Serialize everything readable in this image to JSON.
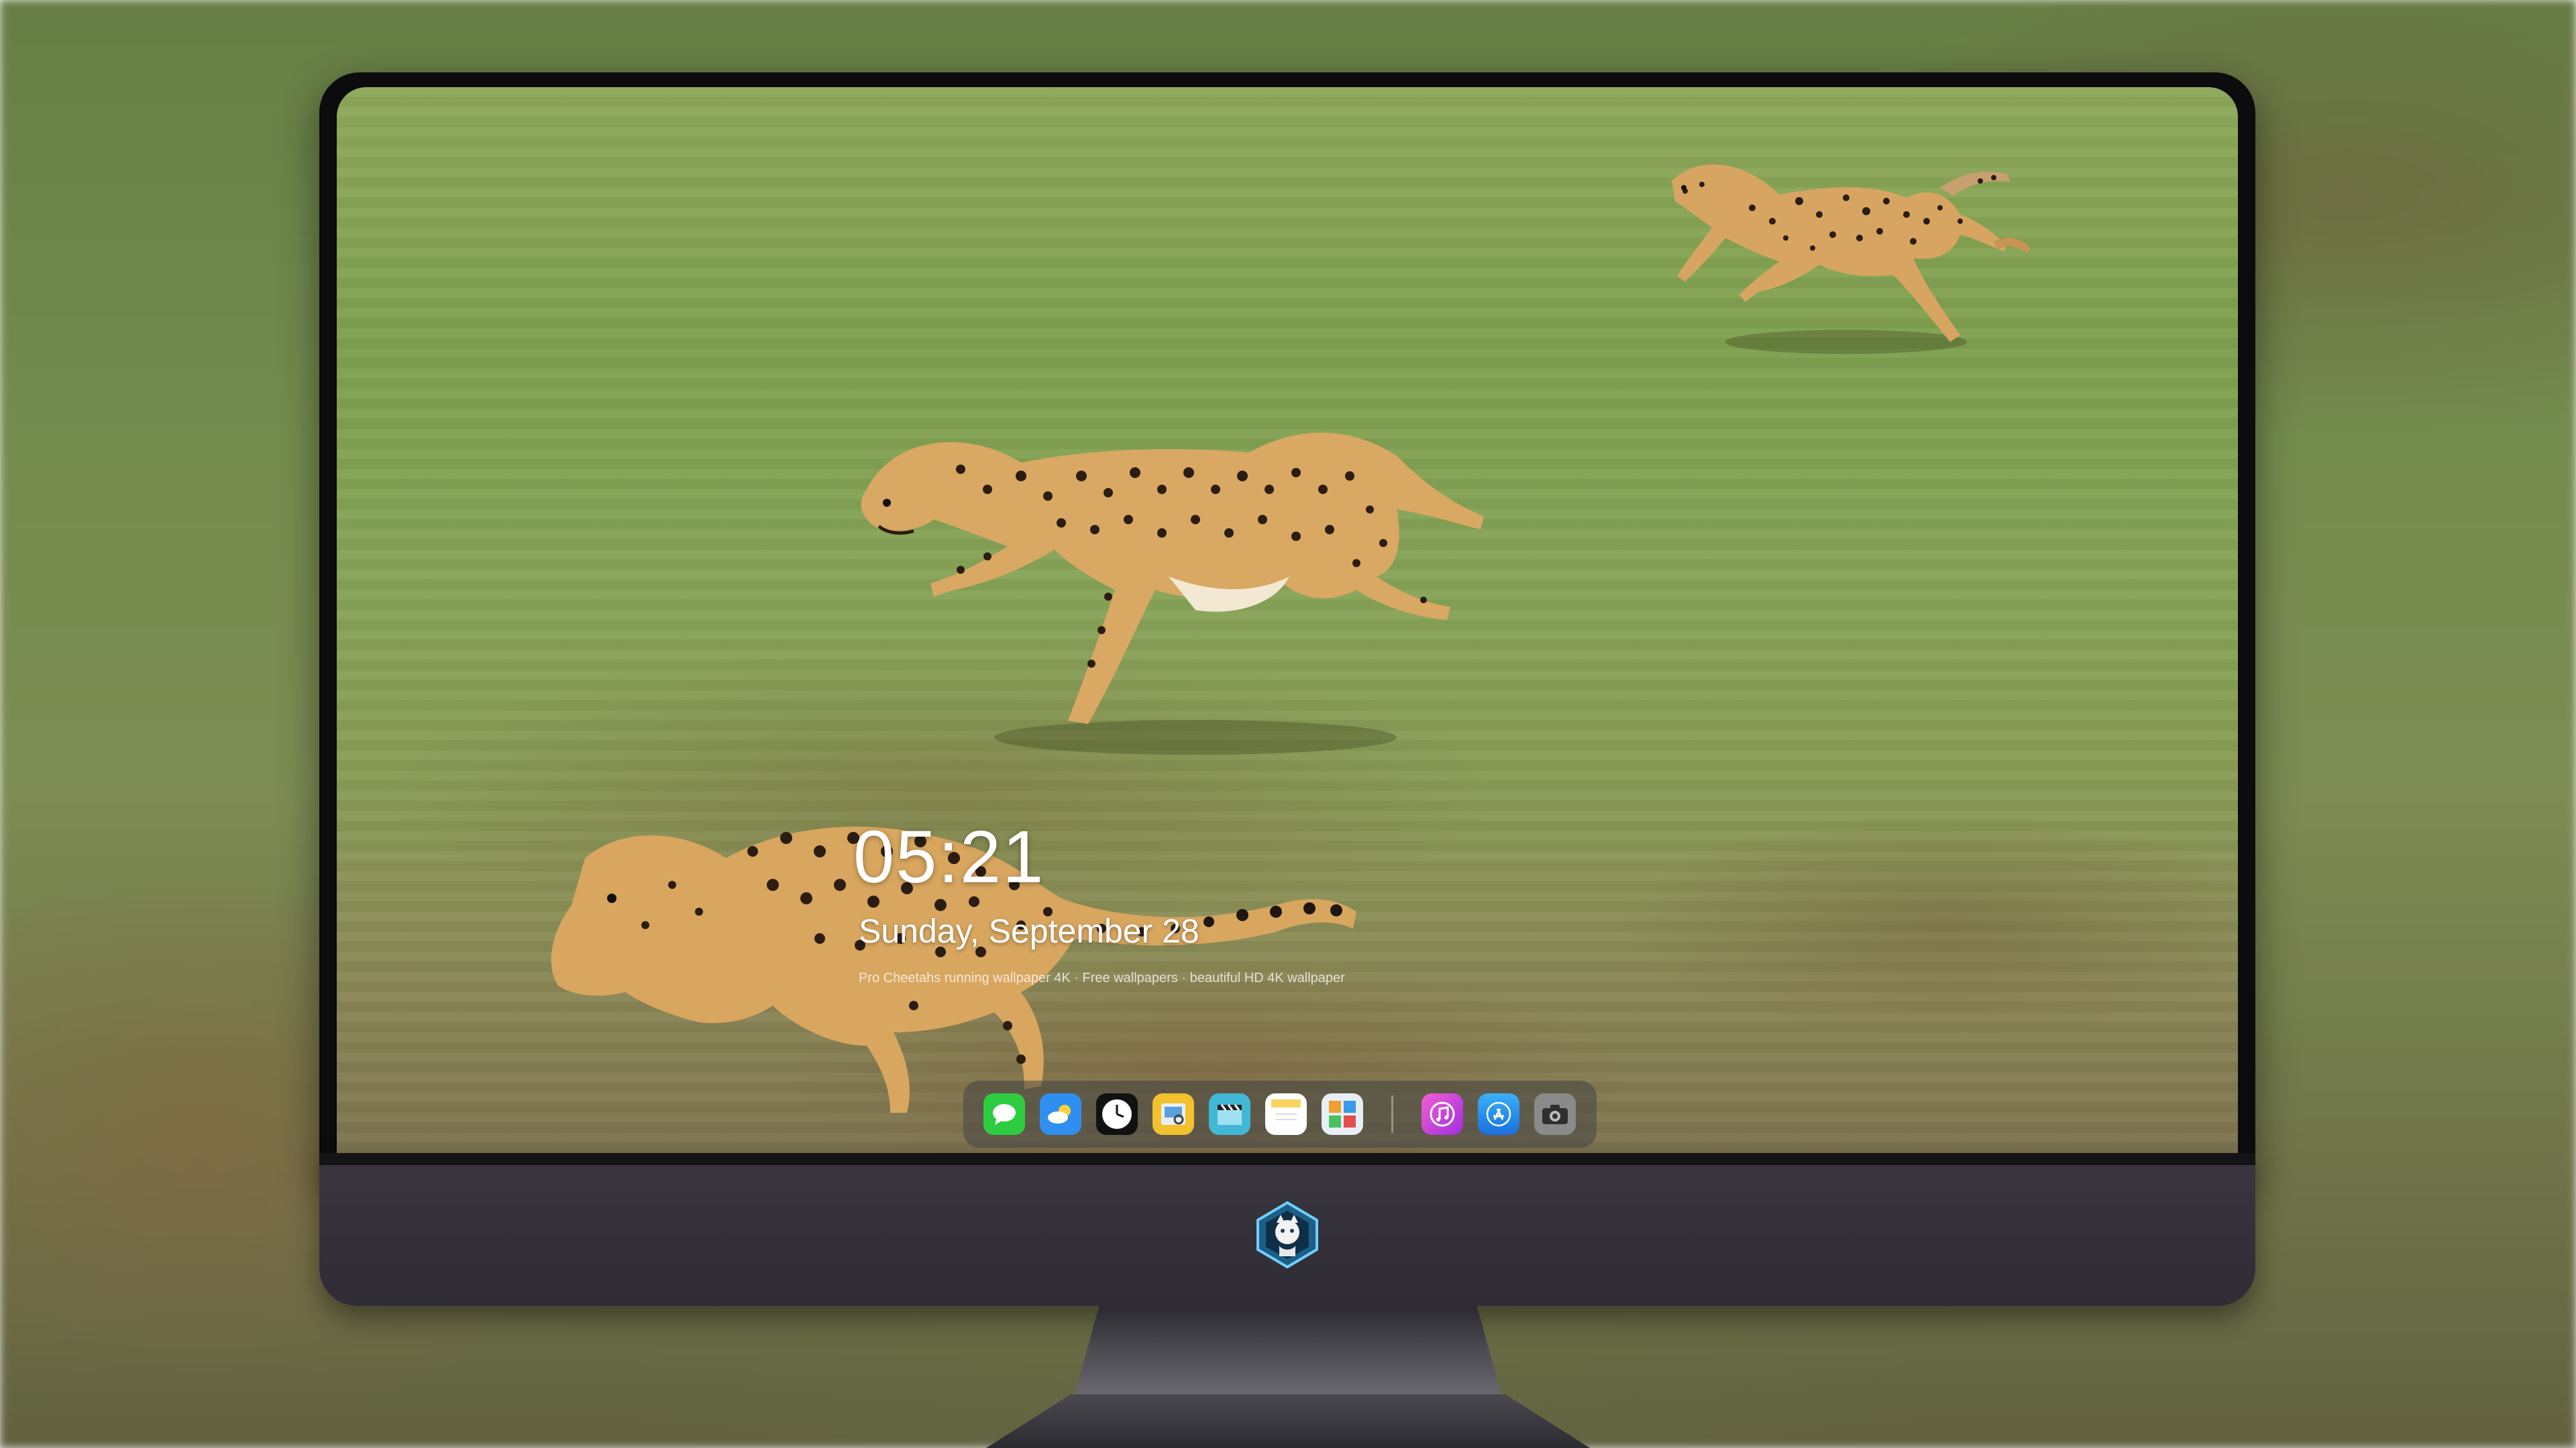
{
  "lock_screen": {
    "time": "05:21",
    "date": "Sunday, September 28",
    "wallpaper_credit": "Pro Cheetahs running wallpaper 4K · Free wallpapers · beautiful HD 4K wallpaper"
  },
  "dock": {
    "items": [
      {
        "name": "Messages",
        "icon": "messages-icon",
        "color": "#2ecc40"
      },
      {
        "name": "Weather",
        "icon": "weather-icon",
        "color": "#2f8ff0"
      },
      {
        "name": "Clock",
        "icon": "clock-icon",
        "color": "#111111"
      },
      {
        "name": "Preview",
        "icon": "preview-icon",
        "color": "#f2c12e"
      },
      {
        "name": "Final Cut",
        "icon": "clapperboard-icon",
        "color": "#41b8d6"
      },
      {
        "name": "Notes",
        "icon": "notes-icon",
        "color": "#f7d560"
      },
      {
        "name": "Photo Gallery",
        "icon": "gallery-icon",
        "color": "#5fb0e8"
      }
    ],
    "pinned": [
      {
        "name": "Music",
        "icon": "music-icon",
        "color": "#c13ce0"
      },
      {
        "name": "App Store",
        "icon": "app-store-icon",
        "color": "#1e88f0"
      },
      {
        "name": "Camera",
        "icon": "camera-icon",
        "color": "#8a8a8a"
      }
    ]
  },
  "device": {
    "logo": "mascot-logo-icon"
  }
}
